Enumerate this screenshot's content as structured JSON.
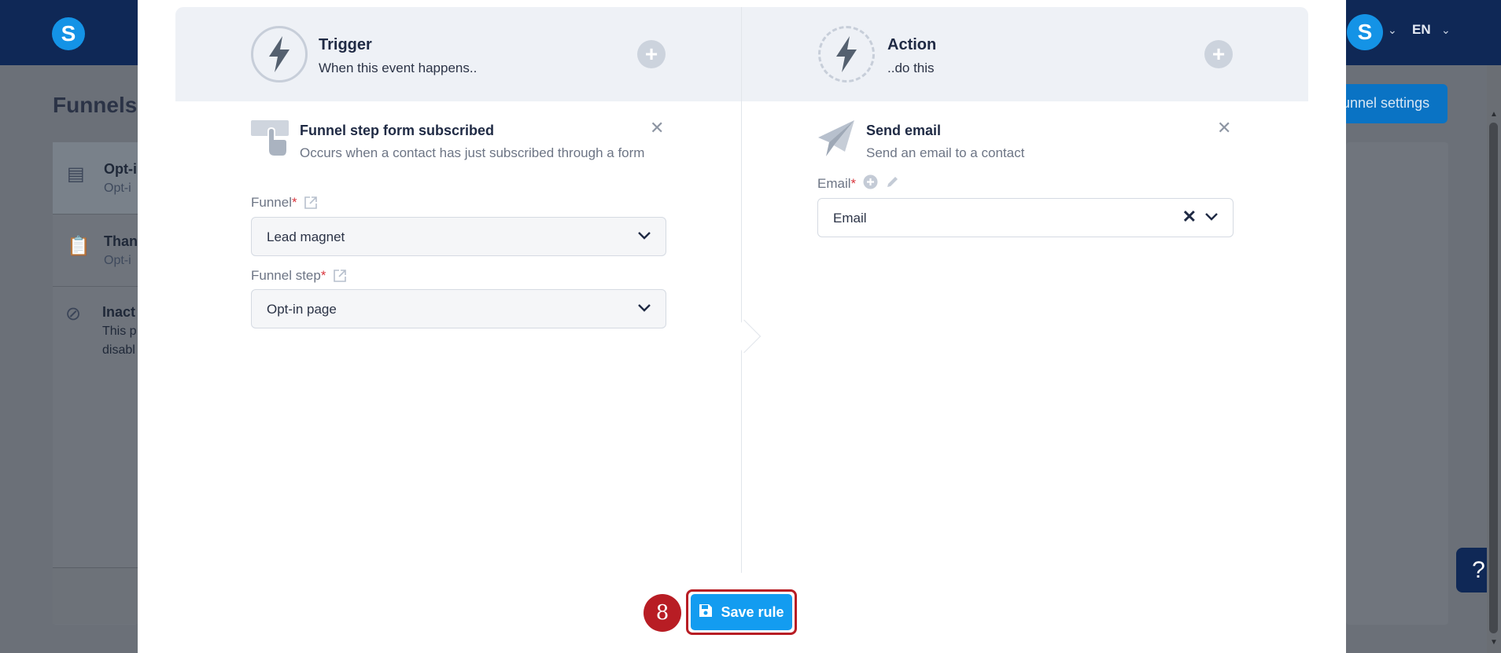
{
  "app": {
    "logo_letter": "S",
    "avatar_letter": "S",
    "language": "EN",
    "page_title": "Funnels",
    "funnel_settings_label": "unnel settings",
    "help_label": "?"
  },
  "background_steps": [
    {
      "title": "Opt-i",
      "subtitle": "Opt-i"
    },
    {
      "title": "Than",
      "subtitle": "Opt-i"
    },
    {
      "title": "Inact",
      "subtitle": "This p",
      "subtitle2": "disabl"
    }
  ],
  "trigger": {
    "title": "Trigger",
    "subtitle": "When this event happens..",
    "card_title": "Funnel step form subscribed",
    "card_desc": "Occurs when a contact has just subscribed through a form",
    "funnel_label": "Funnel",
    "funnel_value": "Lead magnet",
    "step_label": "Funnel step",
    "step_value": "Opt-in page"
  },
  "action": {
    "title": "Action",
    "subtitle": "..do this",
    "card_title": "Send email",
    "card_desc": "Send an email to a contact",
    "email_label": "Email",
    "email_value": "Email"
  },
  "required_mark": "*",
  "save_button": {
    "label": "Save rule"
  },
  "step_badge": "8",
  "colors": {
    "primary": "#139cf0",
    "highlight": "#b81d24",
    "navbar": "#0f2856"
  }
}
